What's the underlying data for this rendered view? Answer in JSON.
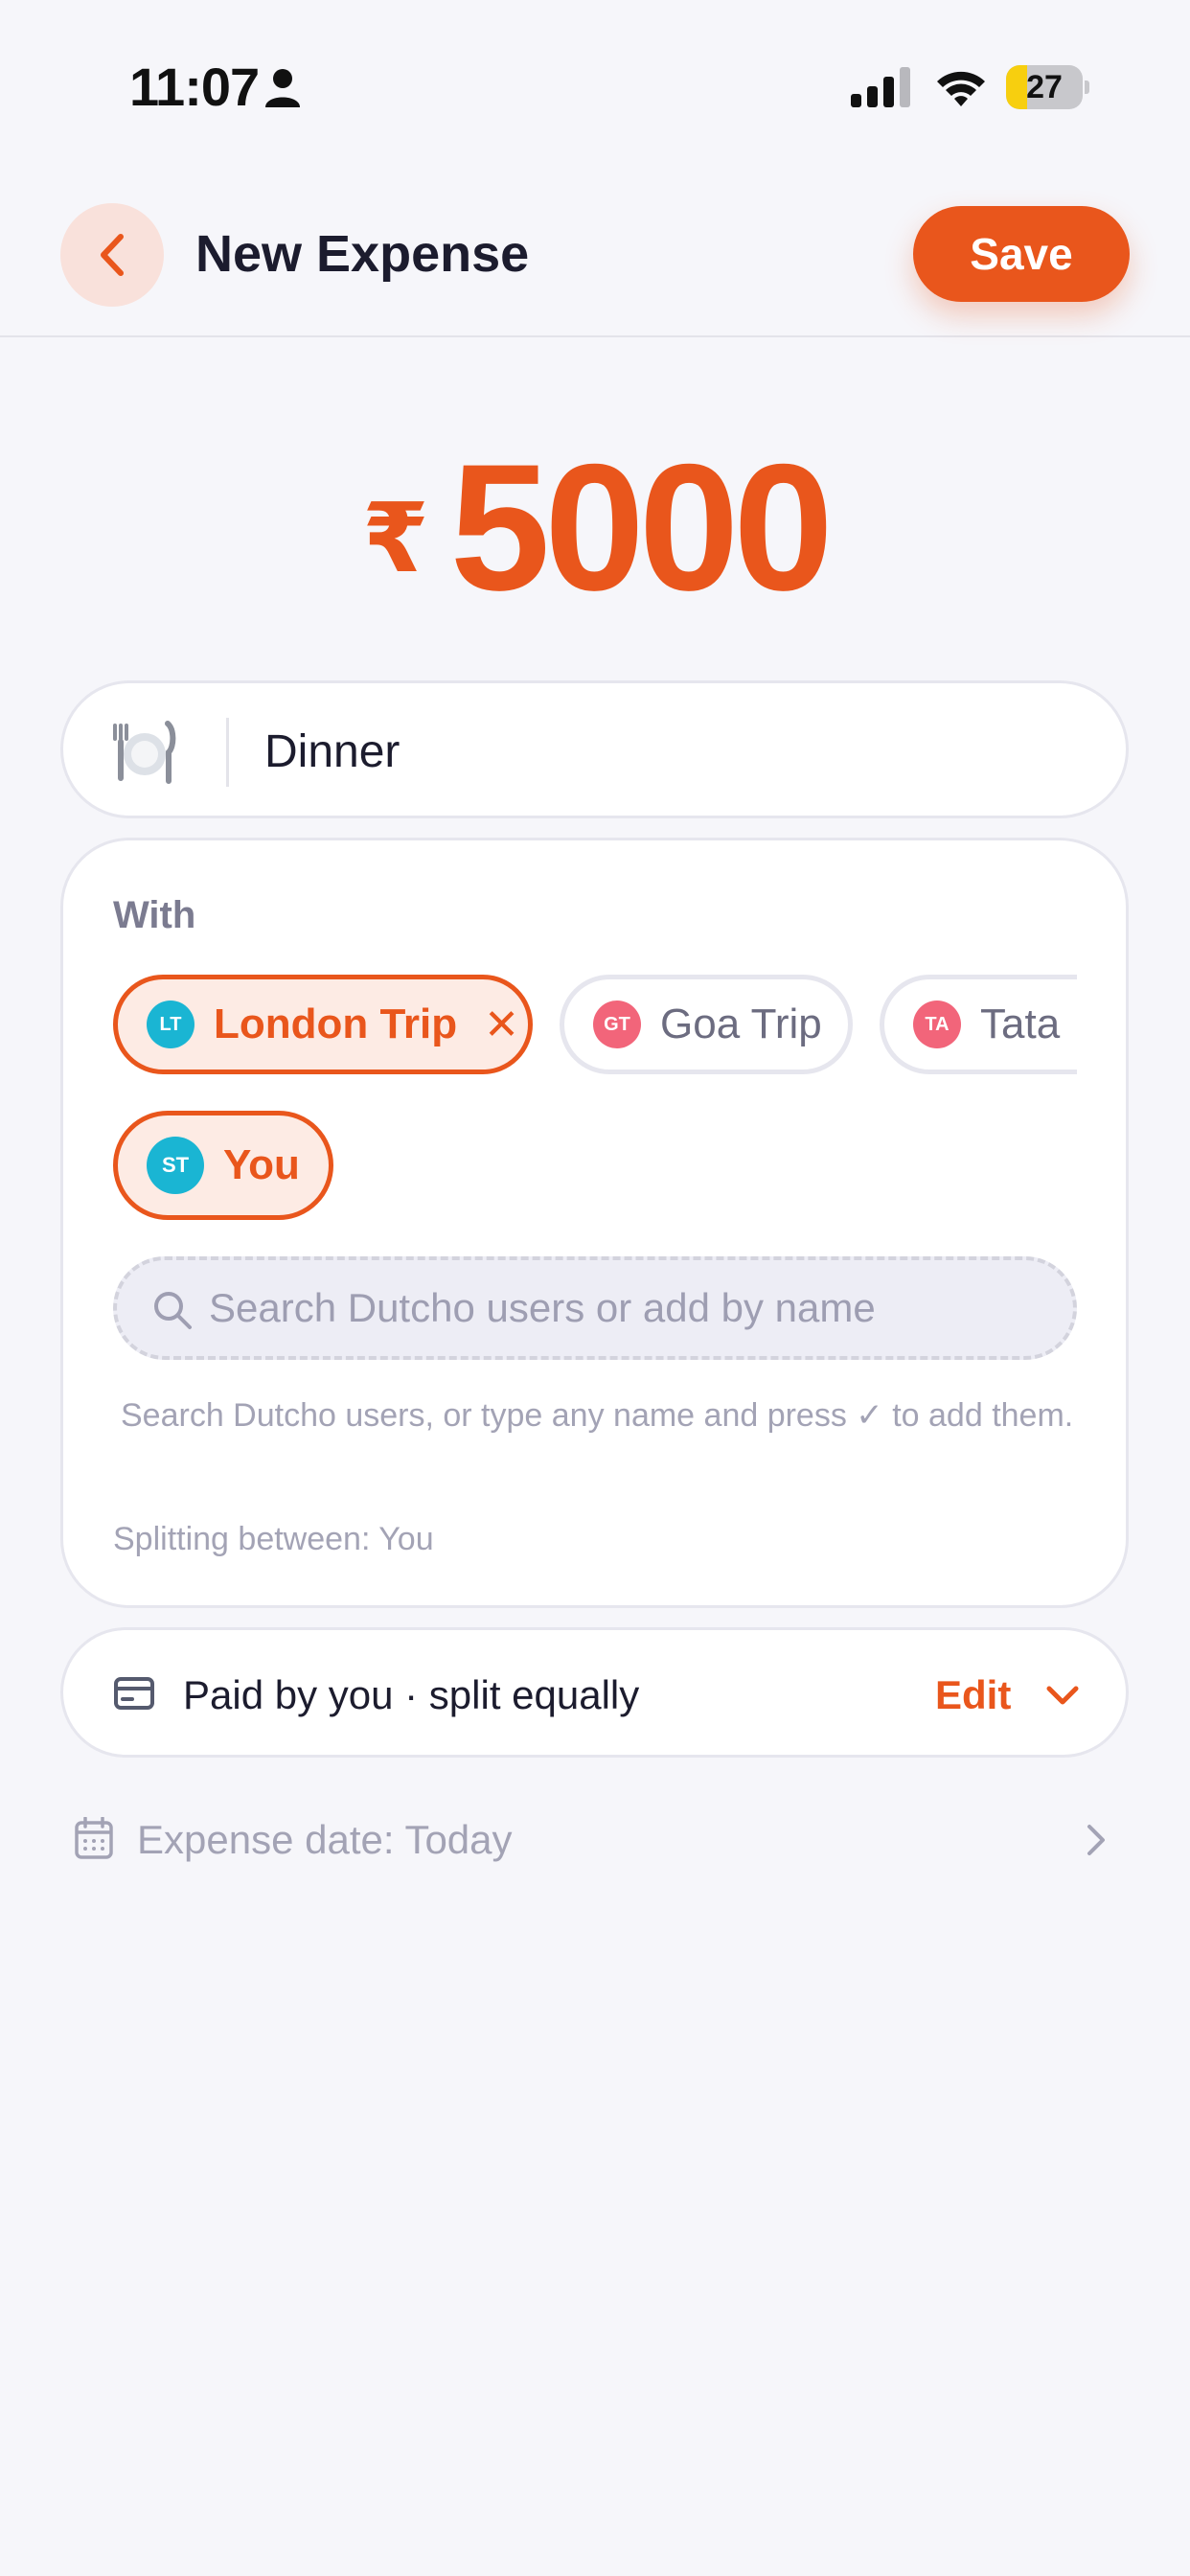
{
  "status_bar": {
    "time": "11:07",
    "battery_level": "27",
    "battery_fraction": 0.27,
    "icons": [
      "person-icon",
      "signal-icon",
      "wifi-icon",
      "battery-icon"
    ]
  },
  "header": {
    "title": "New Expense",
    "save_label": "Save",
    "back_icon": "chevron-left-icon"
  },
  "amount": {
    "currency": "₹",
    "value": "5000"
  },
  "description": {
    "icon": "plate-cutlery-icon",
    "value": "Dinner"
  },
  "with_section": {
    "label": "With",
    "chips": [
      {
        "initials": "LT",
        "label": "London Trip",
        "selected": true,
        "removable": true,
        "avatar_color": "#1ab5d3",
        "remove_symbol": "✕"
      },
      {
        "initials": "GT",
        "label": "Goa Trip",
        "selected": false,
        "avatar_color": "#f2657a"
      },
      {
        "initials": "TA",
        "label": "Tata",
        "selected": false,
        "avatar_color": "#f2657a"
      }
    ],
    "you_chip": {
      "initials": "ST",
      "label": "You",
      "selected": true,
      "avatar_color": "#1ab5d3"
    },
    "search_placeholder": "Search Dutcho users or add by name",
    "hint": "Search Dutcho users, or type any name and press ✓ to add them.",
    "splitting": "Splitting between: You"
  },
  "paid_by": {
    "icon": "credit-card-icon",
    "text": "Paid by you · split equally",
    "edit_label": "Edit"
  },
  "expense_date": {
    "icon": "calendar-icon",
    "text": "Expense date: Today"
  },
  "colors": {
    "accent": "#e9561c",
    "background": "#f6f6fa"
  }
}
